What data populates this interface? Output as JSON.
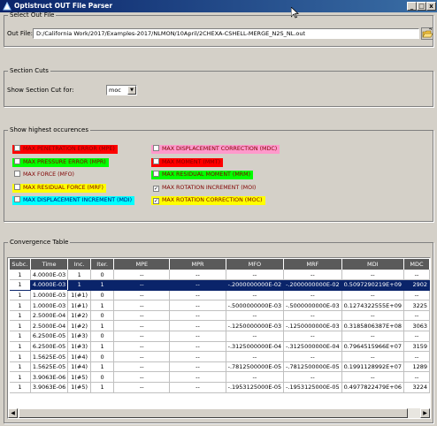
{
  "window": {
    "title": "Optistruct OUT File Parser",
    "minimize": "_",
    "maximize": "□",
    "close": "x"
  },
  "select_out_file": {
    "legend": "Select Out File",
    "label": "Out File:",
    "value": "D:/California Work/2017/Examples-2017/NLMON/10April/2CHEXA-CSHELL-MERGE_N2S_NL.out"
  },
  "section_cuts": {
    "legend": "Section Cuts",
    "label": "Show Section Cut for:",
    "selected": "moc"
  },
  "occurrences": {
    "legend": "Show highest occurences",
    "items": [
      {
        "label": "MAX PENETRATION ERROR (MPE)",
        "color": "#ff0000",
        "text_color": "#800000",
        "checked": false
      },
      {
        "label": "MAX DISPLACEMENT CORRECTION (MDC)",
        "color": "#ff99cc",
        "text_color": "#800000",
        "checked": false
      },
      {
        "label": "MAX PRESSURE ERROR (MPR)",
        "color": "#00ff00",
        "text_color": "#800000",
        "checked": false
      },
      {
        "label": "MAX MOMENT (MMT)",
        "color": "#ff0000",
        "text_color": "#800000",
        "checked": false
      },
      {
        "label": "MAX FORCE (MFO)",
        "color": "#d4d0c8",
        "text_color": "#800000",
        "checked": false
      },
      {
        "label": "MAX RESIDUAL MOMENT (MRM)",
        "color": "#00ff00",
        "text_color": "#800000",
        "checked": false
      },
      {
        "label": "MAX RESIDUAL FORCE (MRF)",
        "color": "#ffff00",
        "text_color": "#800000",
        "checked": false
      },
      {
        "label": "MAX ROTATION INCREMENT (MOI)",
        "color": "#d4d0c8",
        "text_color": "#800000",
        "checked": true
      },
      {
        "label": "MAX DISPLACEMENT INCREMENT (MDI)",
        "color": "#00ffff",
        "text_color": "#000080",
        "checked": false
      },
      {
        "label": "MAX ROTATION CORRECTION (MOC)",
        "color": "#ffff00",
        "text_color": "#800000",
        "checked": true
      }
    ]
  },
  "convergence": {
    "legend": "Convergence Table",
    "columns": [
      "Subc.",
      "Time",
      "Inc.",
      "Iter.",
      "MPE",
      "MPR",
      "MFO",
      "MRF",
      "MDI",
      "MDC"
    ],
    "rows": [
      [
        "1",
        "4.0000E-03",
        "1",
        "0",
        "--",
        "--",
        "--",
        "--",
        "--",
        "--"
      ],
      [
        "1",
        "4.0000E-03",
        "1",
        "1",
        "--",
        "--",
        "-.2000000000E-02",
        "-.2000000000E-02",
        "0.5097290219E+09",
        "2902"
      ],
      [
        "1",
        "1.0000E-03",
        "1(#1)",
        "0",
        "--",
        "--",
        "--",
        "--",
        "--",
        "--"
      ],
      [
        "1",
        "1.0000E-03",
        "1(#1)",
        "1",
        "--",
        "--",
        "-.5000000000E-03",
        "-.5000000000E-03",
        "0.1274322555E+09",
        "3225"
      ],
      [
        "1",
        "2.5000E-04",
        "1(#2)",
        "0",
        "--",
        "--",
        "--",
        "--",
        "--",
        "--"
      ],
      [
        "1",
        "2.5000E-04",
        "1(#2)",
        "1",
        "--",
        "--",
        "-.1250000000E-03",
        "-.1250000000E-03",
        "0.3185806387E+08",
        "3063"
      ],
      [
        "1",
        "6.2500E-05",
        "1(#3)",
        "0",
        "--",
        "--",
        "--",
        "--",
        "--",
        "--"
      ],
      [
        "1",
        "6.2500E-05",
        "1(#3)",
        "1",
        "--",
        "--",
        "-.3125000000E-04",
        "-.3125000000E-04",
        "0.7964515966E+07",
        "3159"
      ],
      [
        "1",
        "1.5625E-05",
        "1(#4)",
        "0",
        "--",
        "--",
        "--",
        "--",
        "--",
        "--"
      ],
      [
        "1",
        "1.5625E-05",
        "1(#4)",
        "1",
        "--",
        "--",
        "-.7812500000E-05",
        "-.7812500000E-05",
        "0.1991128992E+07",
        "1289"
      ],
      [
        "1",
        "3.9063E-06",
        "1(#5)",
        "0",
        "--",
        "--",
        "--",
        "--",
        "--",
        "--"
      ],
      [
        "1",
        "3.9063E-06",
        "1(#5)",
        "1",
        "--",
        "--",
        "-.1953125000E-05",
        "-.1953125000E-05",
        "0.4977822479E+06",
        "3224"
      ]
    ],
    "selected_row": 1
  },
  "colors": {
    "titlebar": "#0a246a",
    "selection": "#0a246a",
    "header": "#5a5a5a",
    "face": "#d4d0c8"
  }
}
